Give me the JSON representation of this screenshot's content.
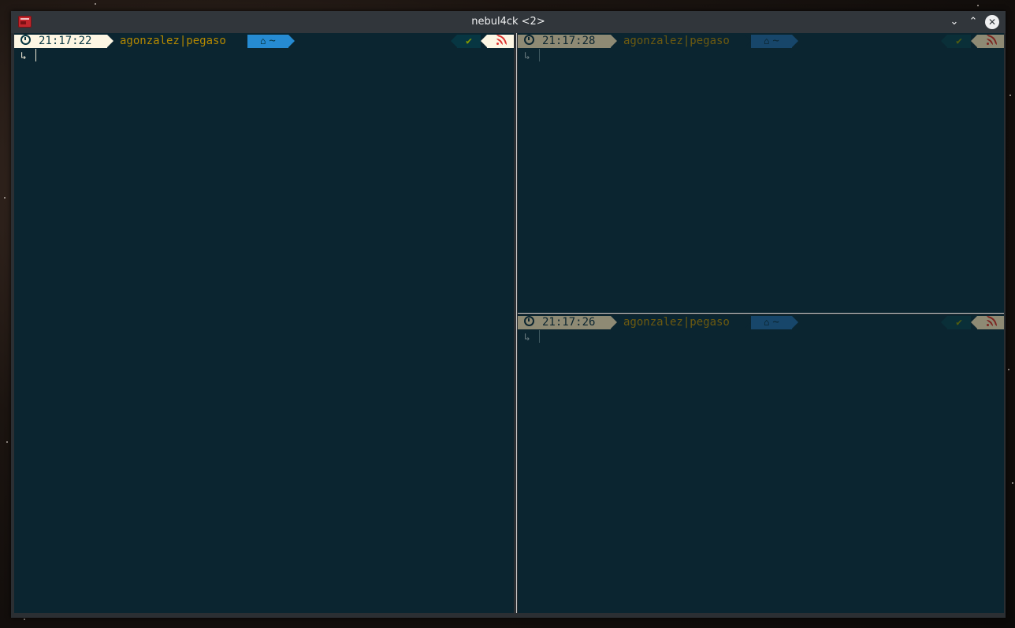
{
  "window": {
    "title": "nebul4ck <2>",
    "app_icon": "terminal-app-icon",
    "controls": {
      "minimize_glyph": "⌄",
      "maximize_glyph": "⌃",
      "close_glyph": "✕"
    }
  },
  "panes": [
    {
      "id": "left",
      "active": true,
      "time": "21:17:22",
      "user_host": "agonzalez|pegaso",
      "dir": "~",
      "status": "✔",
      "prompt": "↳"
    },
    {
      "id": "top-right",
      "active": false,
      "time": "21:17:28",
      "user_host": "agonzalez|pegaso",
      "dir": "~",
      "status": "✔",
      "prompt": "↳"
    },
    {
      "id": "bottom-right",
      "active": false,
      "time": "21:17:26",
      "user_host": "agonzalez|pegaso",
      "dir": "~",
      "status": "✔",
      "prompt": "↳"
    }
  ],
  "colors": {
    "terminal_bg": "#0b2530",
    "time_bg": "#fdf6e3",
    "user_fg": "#b58900",
    "dir_bg": "#268bd2",
    "ok_fg": "#859900",
    "rss_fg": "#dc322f"
  }
}
